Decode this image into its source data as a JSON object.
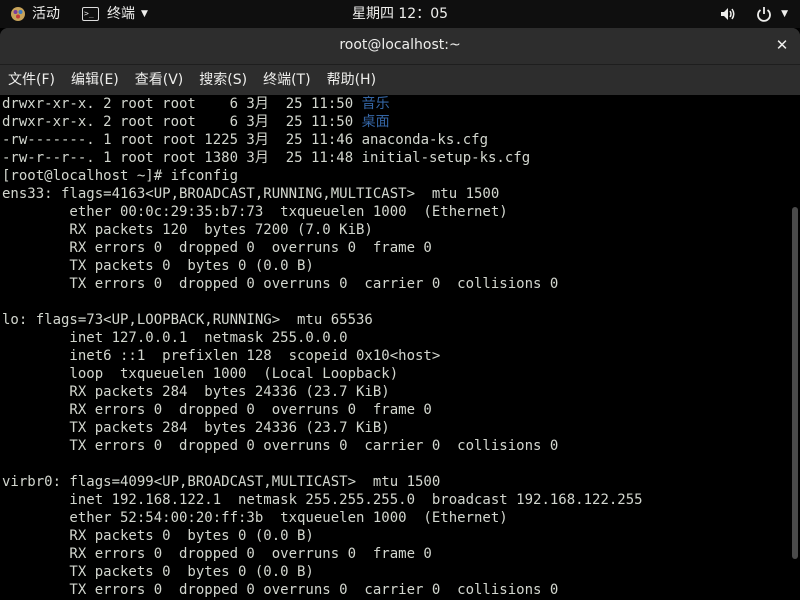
{
  "topbar": {
    "activities": "活动",
    "app_name": "终端",
    "clock": "星期四 12：05",
    "icons": [
      "app-logo-icon",
      "terminal-app-icon",
      "chevron-down-icon",
      "volume-icon",
      "power-icon",
      "chevron-down-icon"
    ]
  },
  "window": {
    "title": "root@localhost:~"
  },
  "menu": [
    "文件(F)",
    "编辑(E)",
    "查看(V)",
    "搜索(S)",
    "终端(T)",
    "帮助(H)"
  ],
  "terminal": {
    "colors": {
      "fg": "#d3d7cf",
      "dir": "#3465a4",
      "bg": "#000000"
    },
    "lines": [
      {
        "pre": "drwxr-xr-x. 2 root root    6 3月  25 11:50 ",
        "hl": "音乐"
      },
      {
        "pre": "drwxr-xr-x. 2 root root    6 3月  25 11:50 ",
        "hl": "桌面"
      },
      {
        "pre": "-rw-------. 1 root root 1225 3月  25 11:46 anaconda-ks.cfg",
        "hl": ""
      },
      {
        "pre": "-rw-r--r--. 1 root root 1380 3月  25 11:48 initial-setup-ks.cfg",
        "hl": ""
      },
      {
        "pre": "[root@localhost ~]# ifconfig",
        "hl": ""
      },
      {
        "pre": "ens33: flags=4163<UP,BROADCAST,RUNNING,MULTICAST>  mtu 1500",
        "hl": ""
      },
      {
        "pre": "        ether 00:0c:29:35:b7:73  txqueuelen 1000  (Ethernet)",
        "hl": ""
      },
      {
        "pre": "        RX packets 120  bytes 7200 (7.0 KiB)",
        "hl": ""
      },
      {
        "pre": "        RX errors 0  dropped 0  overruns 0  frame 0",
        "hl": ""
      },
      {
        "pre": "        TX packets 0  bytes 0 (0.0 B)",
        "hl": ""
      },
      {
        "pre": "        TX errors 0  dropped 0 overruns 0  carrier 0  collisions 0",
        "hl": ""
      },
      {
        "pre": "",
        "hl": ""
      },
      {
        "pre": "lo: flags=73<UP,LOOPBACK,RUNNING>  mtu 65536",
        "hl": ""
      },
      {
        "pre": "        inet 127.0.0.1  netmask 255.0.0.0",
        "hl": ""
      },
      {
        "pre": "        inet6 ::1  prefixlen 128  scopeid 0x10<host>",
        "hl": ""
      },
      {
        "pre": "        loop  txqueuelen 1000  (Local Loopback)",
        "hl": ""
      },
      {
        "pre": "        RX packets 284  bytes 24336 (23.7 KiB)",
        "hl": ""
      },
      {
        "pre": "        RX errors 0  dropped 0  overruns 0  frame 0",
        "hl": ""
      },
      {
        "pre": "        TX packets 284  bytes 24336 (23.7 KiB)",
        "hl": ""
      },
      {
        "pre": "        TX errors 0  dropped 0 overruns 0  carrier 0  collisions 0",
        "hl": ""
      },
      {
        "pre": "",
        "hl": ""
      },
      {
        "pre": "virbr0: flags=4099<UP,BROADCAST,MULTICAST>  mtu 1500",
        "hl": ""
      },
      {
        "pre": "        inet 192.168.122.1  netmask 255.255.255.0  broadcast 192.168.122.255",
        "hl": ""
      },
      {
        "pre": "        ether 52:54:00:20:ff:3b  txqueuelen 1000  (Ethernet)",
        "hl": ""
      },
      {
        "pre": "        RX packets 0  bytes 0 (0.0 B)",
        "hl": ""
      },
      {
        "pre": "        RX errors 0  dropped 0  overruns 0  frame 0",
        "hl": ""
      },
      {
        "pre": "        TX packets 0  bytes 0 (0.0 B)",
        "hl": ""
      },
      {
        "pre": "        TX errors 0  dropped 0 overruns 0  carrier 0  collisions 0",
        "hl": ""
      }
    ]
  }
}
